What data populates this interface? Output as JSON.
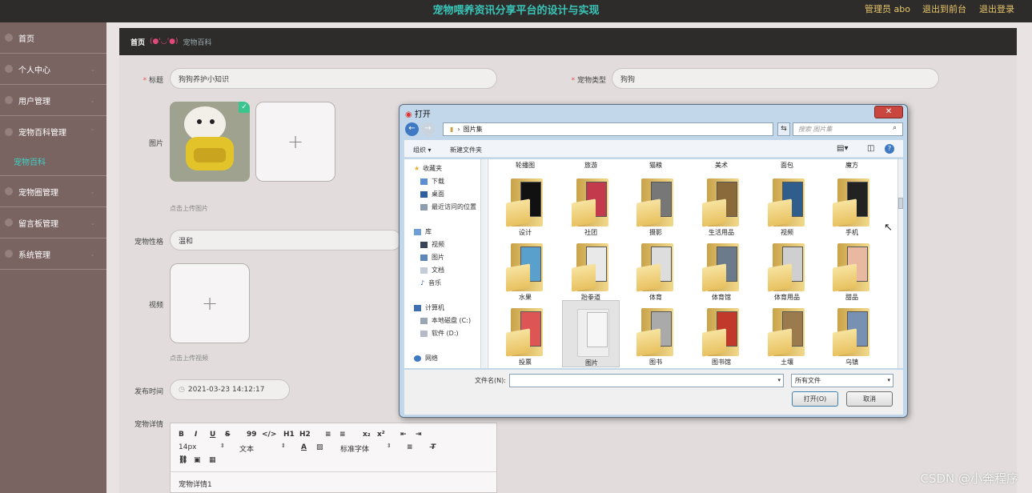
{
  "header": {
    "title": "宠物喂养资讯分享平台的设计与实现",
    "admin": "管理员 abo",
    "to_front": "退出到前台",
    "logout": "退出登录"
  },
  "sidebar": {
    "items": [
      {
        "label": "首页"
      },
      {
        "label": "个人中心"
      },
      {
        "label": "用户管理"
      },
      {
        "label": "宠物百科管理"
      },
      {
        "label": "宠物圈管理"
      },
      {
        "label": "留言板管理"
      },
      {
        "label": "系统管理"
      }
    ],
    "sub_active": "宠物百科"
  },
  "breadcrumb": {
    "home": "首页",
    "face": "(●'◡'●)",
    "current": "宠物百科"
  },
  "form": {
    "title_label": "标题",
    "title_value": "狗狗养护小知识",
    "type_label": "宠物类型",
    "type_value": "狗狗",
    "image_label": "图片",
    "image_hint": "点击上传图片",
    "personality_label": "宠物性格",
    "personality_value": "温和",
    "video_label": "视频",
    "video_hint": "点击上传视频",
    "time_label": "发布时间",
    "time_value": "2021-03-23 14:12:17",
    "detail_label": "宠物详情",
    "editor": {
      "row1": [
        "B",
        "I",
        "U",
        "S",
        "99",
        "</>",
        "H1",
        "H2",
        "≡",
        "≡",
        "x₂",
        "x²",
        "⇤",
        "⇥"
      ],
      "font_size": "14px",
      "text_type": "文本",
      "font_family": "标准字体",
      "content": "宠物详情1"
    }
  },
  "dialog": {
    "title": "打开",
    "path": "图片集",
    "search_placeholder": "搜索 图片集",
    "organize": "组织 ▾",
    "new_folder": "新建文件夹",
    "tree": [
      {
        "label": "收藏夹"
      },
      {
        "label": "下载"
      },
      {
        "label": "桌面"
      },
      {
        "label": "最近访问的位置"
      },
      {
        "label": "库"
      },
      {
        "label": "视频"
      },
      {
        "label": "图片"
      },
      {
        "label": "文档"
      },
      {
        "label": "音乐"
      },
      {
        "label": "计算机"
      },
      {
        "label": "本地磁盘 (C:)"
      },
      {
        "label": "软件 (D:)"
      },
      {
        "label": "网络"
      }
    ],
    "top_row": [
      "轮播图",
      "旅游",
      "猫粮",
      "美术",
      "面包",
      "魔方"
    ],
    "folders": [
      {
        "name": "设计"
      },
      {
        "name": "社团"
      },
      {
        "name": "摄影"
      },
      {
        "name": "生活用品"
      },
      {
        "name": "视频"
      },
      {
        "name": "手机"
      },
      {
        "name": "水果"
      },
      {
        "name": "跆拳道"
      },
      {
        "name": "体育"
      },
      {
        "name": "体育馆"
      },
      {
        "name": "体育用品"
      },
      {
        "name": "甜品"
      },
      {
        "name": "投票"
      },
      {
        "name": "图片"
      },
      {
        "name": "图书"
      },
      {
        "name": "图书馆"
      },
      {
        "name": "土壤"
      },
      {
        "name": "乌镇"
      }
    ],
    "filename_label": "文件名(N):",
    "filetype": "所有文件",
    "open": "打开(O)",
    "cancel": "取消"
  },
  "watermark": "CSDN @小奔程序"
}
